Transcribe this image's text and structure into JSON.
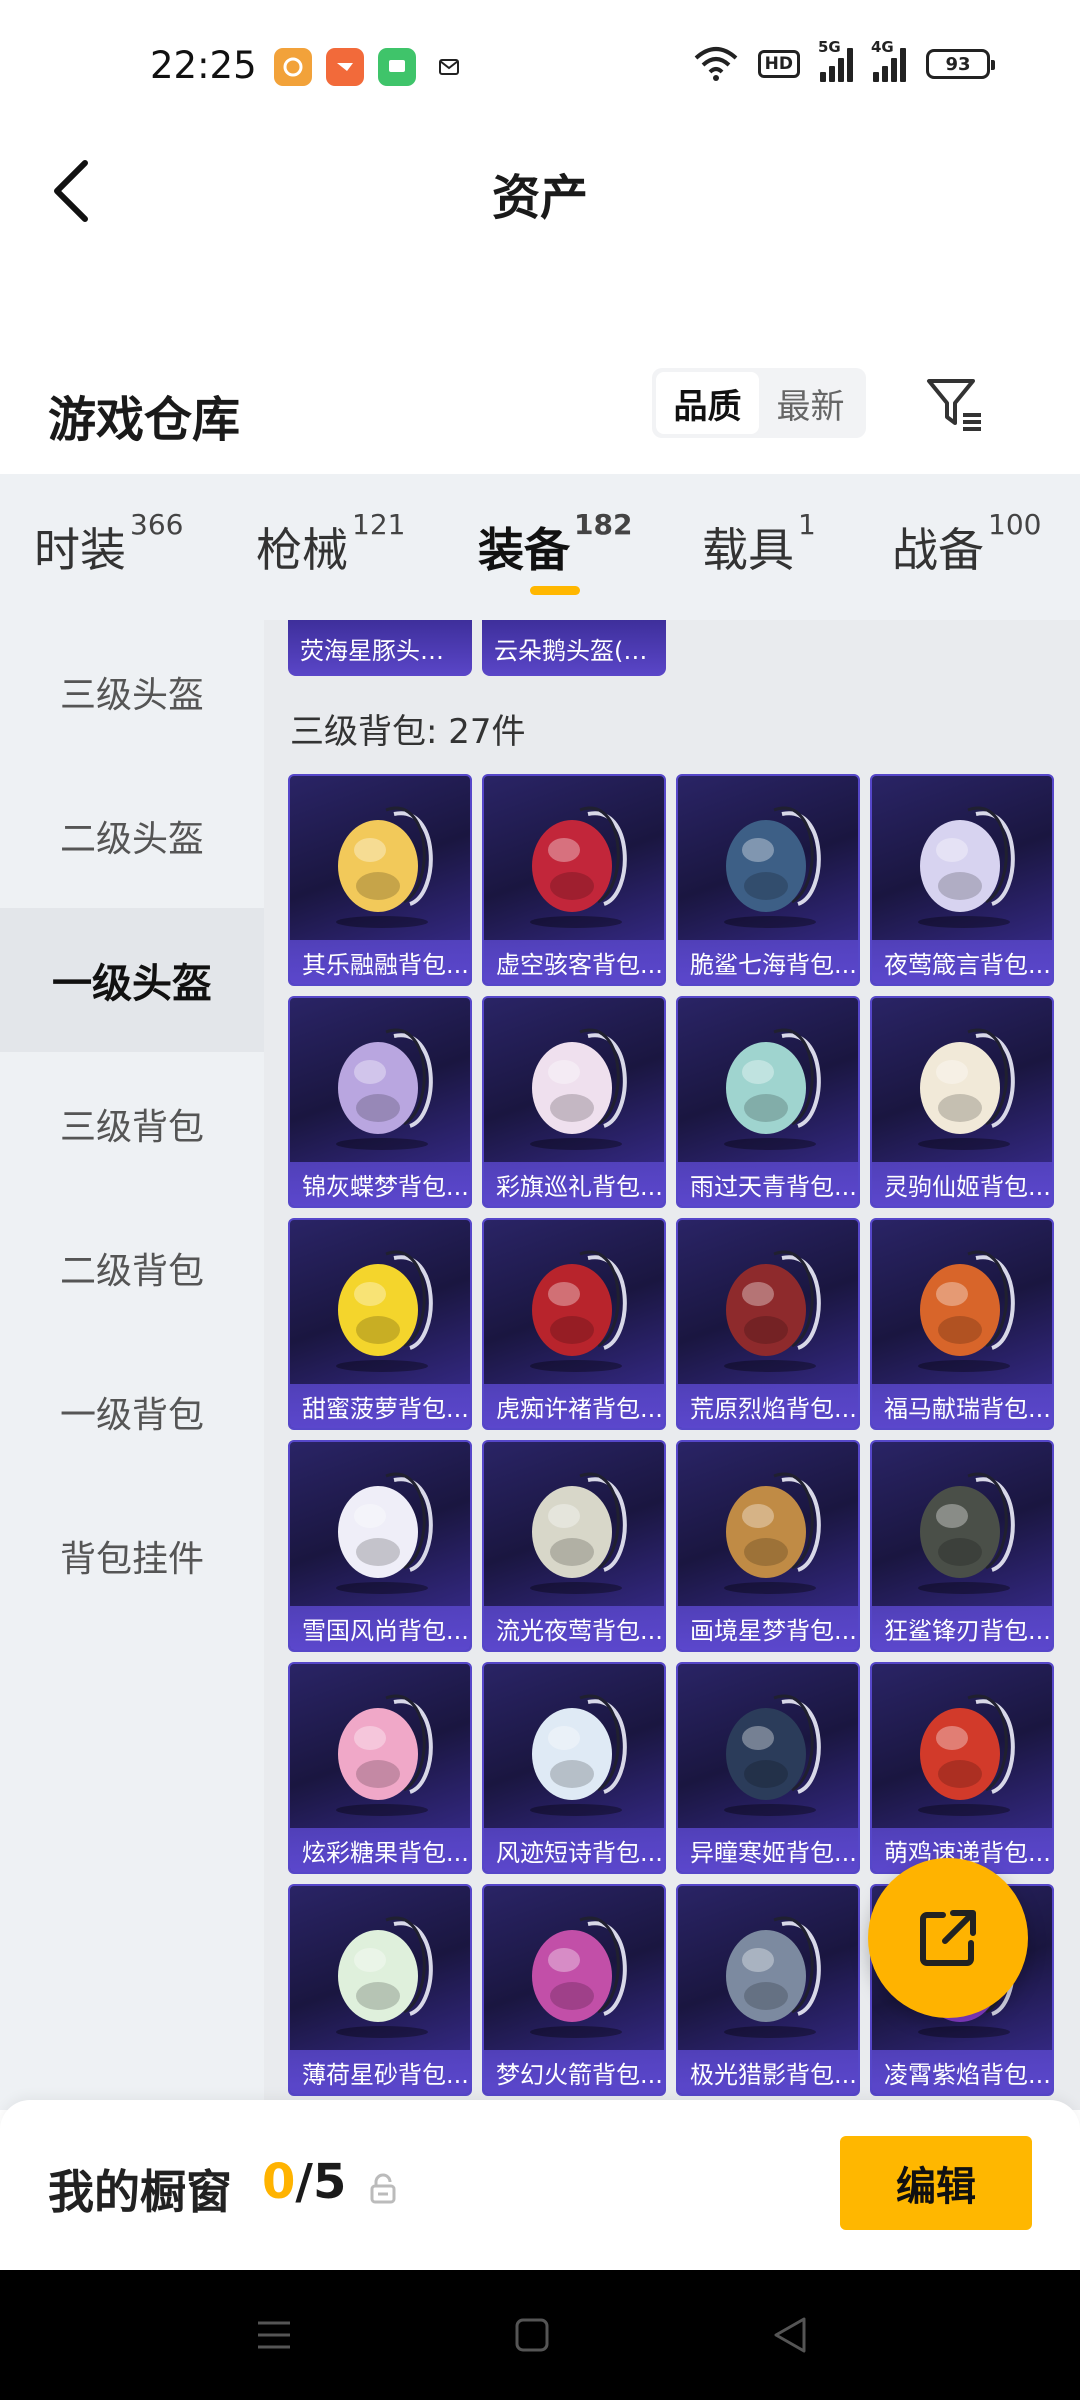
{
  "status_bar": {
    "time": "22:25",
    "apps": [
      "app-icon-1",
      "app-icon-2",
      "message-icon",
      "mail-icon"
    ],
    "hd": "HD",
    "net1": "5G",
    "net2": "4G",
    "battery": "93"
  },
  "header": {
    "title": "资产"
  },
  "section": {
    "title": "游戏仓库",
    "sort_quality": "品质",
    "sort_newest": "最新"
  },
  "tabs": [
    {
      "label": "时装",
      "count": "366"
    },
    {
      "label": "枪械",
      "count": "121"
    },
    {
      "label": "装备",
      "count": "182"
    },
    {
      "label": "载具",
      "count": "1"
    },
    {
      "label": "战备",
      "count": "100"
    }
  ],
  "sidebar": [
    "三级头盔",
    "二级头盔",
    "一级头盔",
    "三级背包",
    "二级背包",
    "一级背包",
    "背包挂件"
  ],
  "prev_items": [
    "荧海星豚头盔...",
    "云朵鹅头盔(1..."
  ],
  "group_title": "三级背包: 27件",
  "items": [
    "其乐融融背包...",
    "虚空骇客背包...",
    "脆鲨七海背包...",
    "夜莺箴言背包...",
    "锦灰蝶梦背包...",
    "彩旗巡礼背包...",
    "雨过天青背包...",
    "灵驹仙姬背包...",
    "甜蜜菠萝背包...",
    "虎痴许褚背包...",
    "荒原烈焰背包...",
    "福马献瑞背包...",
    "雪国风尚背包...",
    "流光夜莺背包...",
    "画境星梦背包...",
    "狂鲨锋刃背包...",
    "炫彩糖果背包...",
    "风迹短诗背包...",
    "异瞳寒姬背包...",
    "萌鸡速递背包...",
    "薄荷星砂背包...",
    "梦幻火箭背包...",
    "极光猎影背包...",
    "凌霄紫焰背包..."
  ],
  "item_colors": [
    "#f2c95a",
    "#c2263a",
    "#3d5f86",
    "#d7d3f0",
    "#b9a6e0",
    "#efe0ee",
    "#9fd4cf",
    "#f1e9d8",
    "#f4d52c",
    "#b8242c",
    "#8e2a2c",
    "#d8652a",
    "#efeef8",
    "#d8d7c9",
    "#c08b45",
    "#4a4f48",
    "#f0a8c8",
    "#dfeaf5",
    "#2b3c5a",
    "#d23a2a",
    "#dff0dc",
    "#c24fa8",
    "#7c8aa0",
    "#8b3fd0"
  ],
  "showcase": {
    "title": "我的橱窗",
    "current": "0",
    "total": "/5",
    "edit": "编辑"
  }
}
